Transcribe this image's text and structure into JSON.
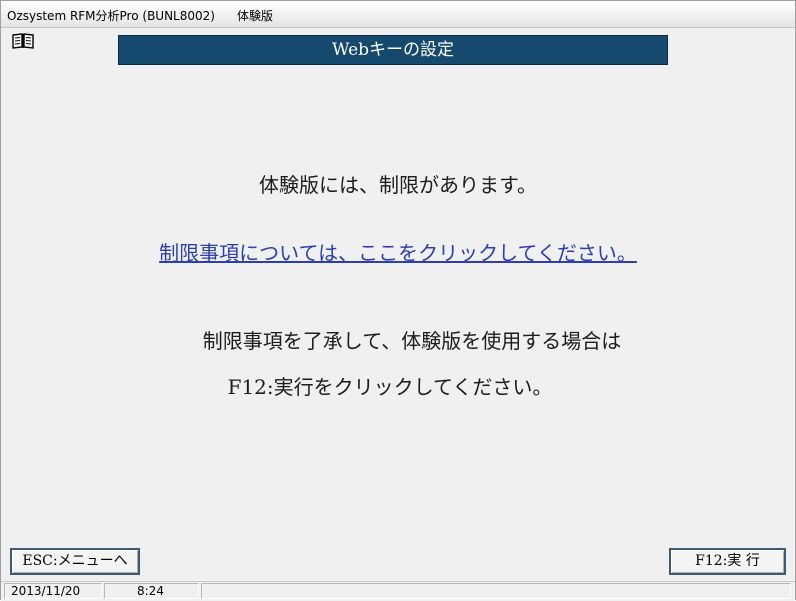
{
  "window": {
    "app_title": "Ozsystem RFM分析Pro (BUNL8002)",
    "edition": "体験版"
  },
  "toolbar": {
    "manual_icon": "open-book-icon"
  },
  "header": {
    "title": "Webキーの設定"
  },
  "main": {
    "limit_notice": "体験版には、制限があります。",
    "details_link": "制限事項については、ここをクリックしてください。",
    "accept_notice": "制限事項を了承して、体験版を使用する場合は",
    "f12_instruction": "F12:実行をクリックしてください。"
  },
  "footer": {
    "esc_button": "ESC:メニューへ",
    "f12_button": "F12:実 行"
  },
  "status": {
    "date": "2013/11/20",
    "time": "8:24"
  },
  "colors": {
    "banner": "#15496d",
    "link": "#2a3fb0"
  }
}
